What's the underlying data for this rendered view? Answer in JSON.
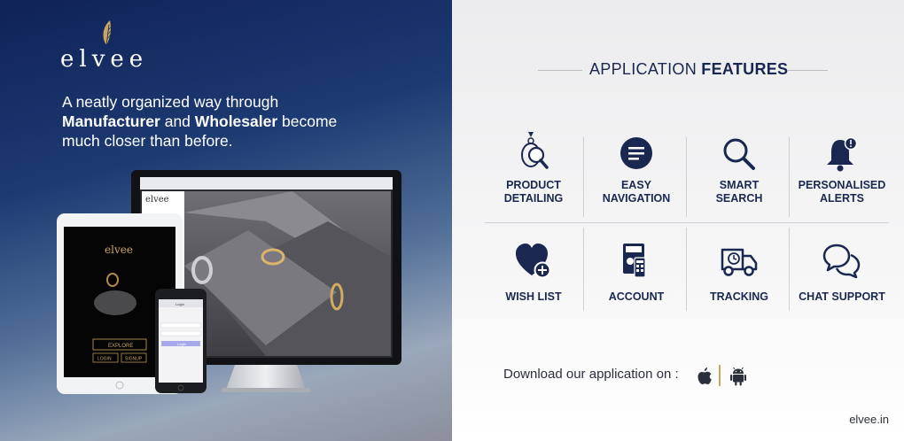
{
  "brand": {
    "logo_text": "elvee"
  },
  "tagline": {
    "line1": "A neatly organized way through",
    "bold1": "Manufacturer",
    "and": " and ",
    "bold2": "Wholesaler",
    "line2_rest": " become",
    "line3": "much closer than before."
  },
  "features_title": {
    "light": "APPLICATION ",
    "bold": "FEATURES"
  },
  "features": [
    {
      "label1": "PRODUCT",
      "label2": "DETAILING",
      "icon": "ring-magnifier-icon"
    },
    {
      "label1": "EASY",
      "label2": "NAVIGATION",
      "icon": "menu-circle-icon"
    },
    {
      "label1": "SMART",
      "label2": "SEARCH",
      "icon": "search-icon"
    },
    {
      "label1": "PERSONALISED",
      "label2": "ALERTS",
      "icon": "bell-alert-icon"
    },
    {
      "label1": "WISH LIST",
      "label2": "",
      "icon": "heart-plus-icon"
    },
    {
      "label1": "ACCOUNT",
      "label2": "",
      "icon": "calculator-icon"
    },
    {
      "label1": "TRACKING",
      "label2": "",
      "icon": "truck-icon"
    },
    {
      "label1": "CHAT SUPPORT",
      "label2": "",
      "icon": "chat-bubbles-icon"
    }
  ],
  "download": {
    "text": "Download our application on :"
  },
  "site": "elvee.in",
  "devices": {
    "ipad_logo": "elvee",
    "ipad_button_explore": "EXPLORE",
    "ipad_button_login": "LOGIN",
    "ipad_button_signup": "SIGNUP",
    "monitor_logo": "elvee",
    "phone_header": "Login",
    "phone_button": "Login"
  },
  "colors": {
    "navy": "#1a2750",
    "gold": "#c8a560"
  }
}
